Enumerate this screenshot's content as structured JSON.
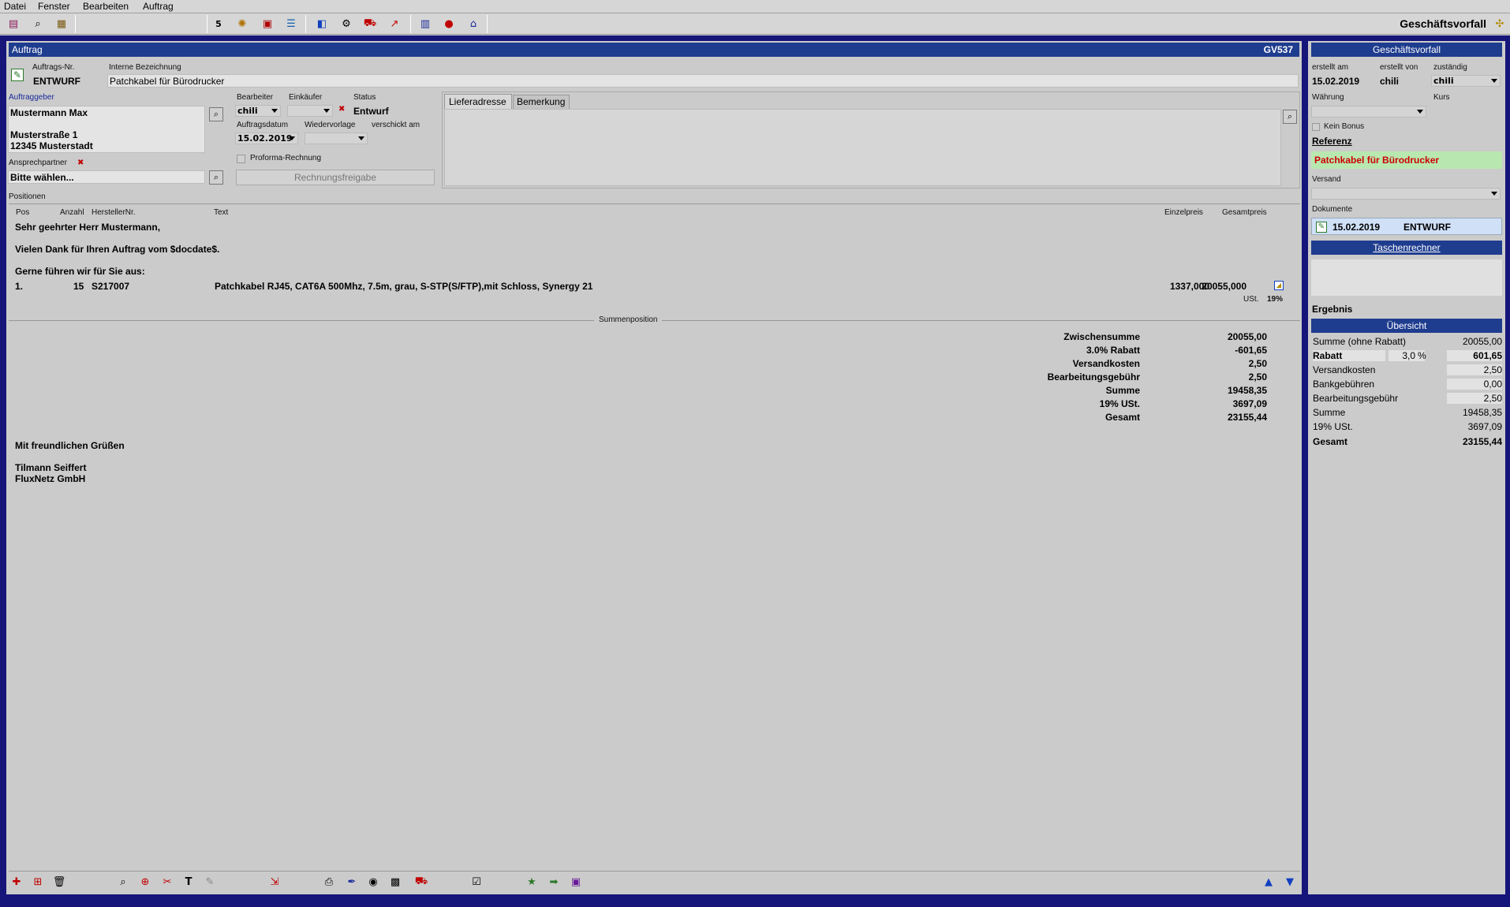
{
  "menu": [
    "Datei",
    "Fenster",
    "Bearbeiten",
    "Auftrag"
  ],
  "toolbar_title": "Geschäftsvorfall",
  "order": {
    "panel_title": "Auftrag",
    "gv_id": "GV537",
    "order_no_label": "Auftrags-Nr.",
    "order_no": "ENTWURF",
    "internal_label": "Interne Bezeichnung",
    "internal_value": "Patchkabel für Bürodrucker",
    "client_label": "Auftraggeber",
    "client_lines": [
      "Mustermann Max",
      "",
      "Musterstraße 1",
      "12345 Musterstadt"
    ],
    "contact_label": "Ansprechpartner",
    "contact_value": "Bitte wählen...",
    "bearbeiter_label": "Bearbeiter",
    "bearbeiter_value": "chili",
    "einkaeufer_label": "Einkäufer",
    "einkaeufer_value": "",
    "status_label": "Status",
    "status_value": "Entwurf",
    "auftragsdatum_label": "Auftragsdatum",
    "auftragsdatum_value": "15.02.2019",
    "wiedervorlage_label": "Wiedervorlage",
    "verschickt_label": "verschickt am",
    "proforma_label": "Proforma-Rechnung",
    "rechnungsfreigabe_label": "Rechnungsfreigabe",
    "tabs": [
      "Lieferadresse",
      "Bemerkung"
    ],
    "positions_label": "Positionen",
    "columns": {
      "pos": "Pos",
      "anzahl": "Anzahl",
      "hersteller": "HerstellerNr.",
      "text": "Text",
      "einzelpreis": "Einzelpreis",
      "gesamtpreis": "Gesamtpreis"
    },
    "intro_lines": [
      "Sehr geehrter Herr Mustermann,",
      "Vielen Dank für Ihren Auftrag vom $docdate$.",
      "Gerne führen wir für Sie aus:"
    ],
    "items": [
      {
        "pos": "1.",
        "anzahl": "15",
        "hersteller": "S217007",
        "text": "Patchkabel RJ45, CAT6A 500Mhz, 7.5m, grau, S-STP(S/FTP),mit Schloss, Synergy 21",
        "einzelpreis": "1337,000",
        "gesamtpreis": "20055,000",
        "ust_label": "USt.",
        "ust_value": "19%"
      }
    ],
    "summenposition_label": "Summenposition",
    "sums": [
      {
        "label": "Zwischensumme",
        "value": "20055,00"
      },
      {
        "label": "3.0% Rabatt",
        "value": "-601,65"
      },
      {
        "label": "Versandkosten",
        "value": "2,50"
      },
      {
        "label": "Bearbeitungsgebühr",
        "value": "2,50"
      },
      {
        "label": "Summe",
        "value": "19458,35"
      },
      {
        "label": "19% USt.",
        "value": "3697,09"
      },
      {
        "label": "Gesamt",
        "value": "23155,44"
      }
    ],
    "closing_lines": [
      "Mit freundlichen Grüßen",
      "",
      "Tilmann Seiffert",
      "FluxNetz GmbH"
    ]
  },
  "side": {
    "title": "Geschäftsvorfall",
    "erstellt_am_label": "erstellt am",
    "erstellt_am": "15.02.2019",
    "erstellt_von_label": "erstellt von",
    "erstellt_von": "chili",
    "zustaendig_label": "zuständig",
    "zustaendig": "chili",
    "waehrung_label": "Währung",
    "kurs_label": "Kurs",
    "kein_bonus_label": "Kein Bonus",
    "referenz_label": "Referenz",
    "referenz_value": "Patchkabel für Bürodrucker",
    "versand_label": "Versand",
    "dokumente_label": "Dokumente",
    "doc_date": "15.02.2019",
    "doc_status": "ENTWURF",
    "taschenrechner_label": "Taschenrechner",
    "ergebnis_label": "Ergebnis",
    "uebersicht_label": "Übersicht",
    "overview": {
      "summe_ohne_rabatt_label": "Summe (ohne Rabatt)",
      "summe_ohne_rabatt": "20055,00",
      "rabatt_label": "Rabatt",
      "rabatt_pct": "3,0",
      "pct_sign": "%",
      "rabatt_value": "601,65",
      "versandkosten_label": "Versandkosten",
      "versandkosten": "2,50",
      "bankgebuehren_label": "Bankgebühren",
      "bankgebuehren": "0,00",
      "bearbeitungsgebuehr_label": "Bearbeitungsgebühr",
      "bearbeitungsgebuehr": "2,50",
      "summe_label": "Summe",
      "summe": "19458,35",
      "ust_label": "19% USt.",
      "ust": "3697,09",
      "gesamt_label": "Gesamt",
      "gesamt": "23155,44"
    }
  },
  "colors": {
    "titlebar": "#1f3d8f",
    "frame": "#15157a",
    "referenz_bg": "#b8e8b0",
    "referenz_text": "#cc0000",
    "doc_bg": "#cfe0f7"
  }
}
